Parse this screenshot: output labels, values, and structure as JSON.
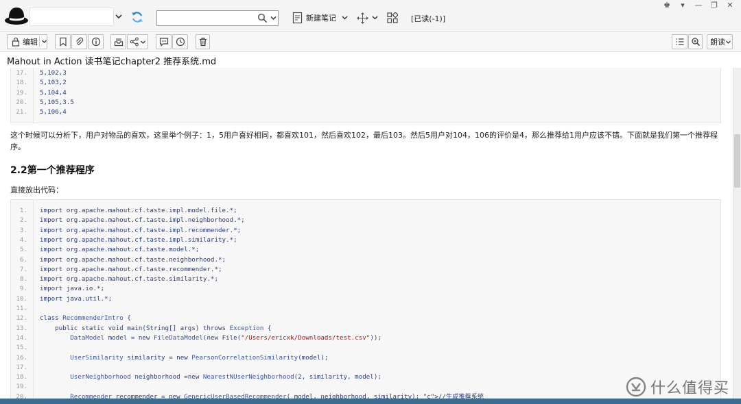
{
  "app": {
    "search_placeholder": "",
    "new_note_label": "新建笔记",
    "read_status": "[已读(-1)]",
    "window_controls": [
      "♚",
      "▾",
      "—",
      "❐",
      "✕"
    ]
  },
  "toolbar": {
    "edit_label": "编辑",
    "read_aloud_label": "朗读"
  },
  "note": {
    "title": "Mahout in Action 读书笔记chapter2 推荐系统.md",
    "paragraph_1": "这个时候可以分析下，用户对物品的喜欢，这里举个例子：1，5用户喜好相同，都喜欢101，然后喜欢102，最后103。然后5用户对104，106的评价是4，那么推荐给1用户应该不错。下面就是我们第一个推荐程序。",
    "heading": "2.2第一个推荐程序",
    "paragraph_2": "直接放出代码："
  },
  "code_block_1": [
    {
      "n": "17.",
      "code": "5,102,3"
    },
    {
      "n": "18.",
      "code": "5,103,2"
    },
    {
      "n": "19.",
      "code": "5,104,4"
    },
    {
      "n": "20.",
      "code": "5,105,3.5"
    },
    {
      "n": "21.",
      "code": "5,106,4"
    }
  ],
  "code_block_2": [
    {
      "n": "1.",
      "code": "import org.apache.mahout.cf.taste.impl.model.file.*;"
    },
    {
      "n": "2.",
      "code": "import org.apache.mahout.cf.taste.impl.neighborhood.*;"
    },
    {
      "n": "3.",
      "code": "import org.apache.mahout.cf.taste.impl.recommender.*;"
    },
    {
      "n": "4.",
      "code": "import org.apache.mahout.cf.taste.impl.similarity.*;"
    },
    {
      "n": "5.",
      "code": "import org.apache.mahout.cf.taste.model.*;"
    },
    {
      "n": "6.",
      "code": "import org.apache.mahout.cf.taste.neighborhood.*;"
    },
    {
      "n": "7.",
      "code": "import org.apache.mahout.cf.taste.recommender.*;"
    },
    {
      "n": "8.",
      "code": "import org.apache.mahout.cf.taste.similarity.*;"
    },
    {
      "n": "9.",
      "code": "import java.io.*;"
    },
    {
      "n": "10.",
      "code": "import java.util.*;"
    },
    {
      "n": "11.",
      "code": ""
    },
    {
      "n": "12.",
      "code": "class RecommenderIntro {"
    },
    {
      "n": "13.",
      "code": "    public static void main(String[] args) throws Exception {"
    },
    {
      "n": "14.",
      "code": "        DataModel model = new FileDataModel(new File(\"/Users/ericxk/Downloads/test.csv\"));"
    },
    {
      "n": "15.",
      "code": ""
    },
    {
      "n": "16.",
      "code": "        UserSimilarity similarity = new PearsonCorrelationSimilarity(model);"
    },
    {
      "n": "17.",
      "code": ""
    },
    {
      "n": "18.",
      "code": "        UserNeighborhood neighborhood =new NearestNUserNeighborhood(2, similarity, model);"
    },
    {
      "n": "19.",
      "code": ""
    },
    {
      "n": "20.",
      "code": "        Recommender recommender = new GenericUserBasedRecommender( model, neighborhood, similarity); //生成推荐系统"
    }
  ],
  "watermark": {
    "text": "什么值得买"
  }
}
